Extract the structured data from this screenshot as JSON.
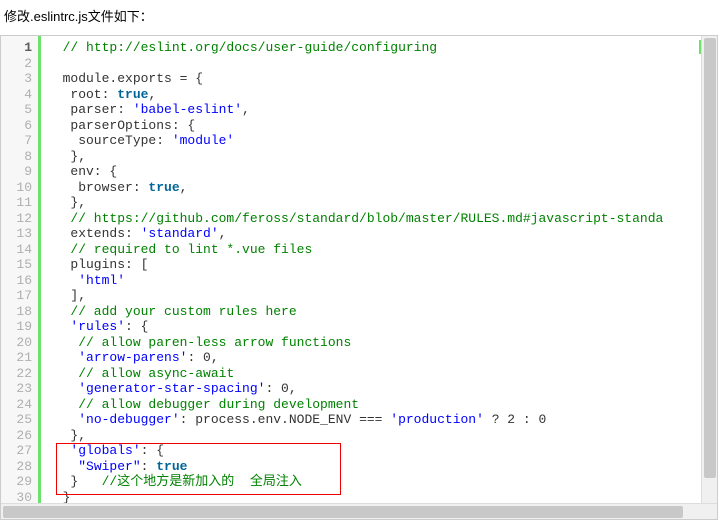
{
  "caption": "修改.eslintrc.js文件如下：",
  "code_lines": [
    {
      "n": 1,
      "hl": true,
      "segs": [
        {
          "t": "  ",
          "c": ""
        },
        {
          "t": "// http://eslint.org/docs/user-guide/configuring",
          "c": "c-comment"
        }
      ]
    },
    {
      "n": 2,
      "hl": false,
      "segs": []
    },
    {
      "n": 3,
      "hl": false,
      "segs": [
        {
          "t": "  module.exports = {",
          "c": ""
        }
      ]
    },
    {
      "n": 4,
      "hl": false,
      "segs": [
        {
          "t": "   root: ",
          "c": ""
        },
        {
          "t": "true",
          "c": "c-key"
        },
        {
          "t": ",",
          "c": ""
        }
      ]
    },
    {
      "n": 5,
      "hl": false,
      "segs": [
        {
          "t": "   parser: ",
          "c": ""
        },
        {
          "t": "'babel-eslint'",
          "c": "c-string"
        },
        {
          "t": ",",
          "c": ""
        }
      ]
    },
    {
      "n": 6,
      "hl": false,
      "segs": [
        {
          "t": "   parserOptions: {",
          "c": ""
        }
      ]
    },
    {
      "n": 7,
      "hl": false,
      "segs": [
        {
          "t": "    sourceType: ",
          "c": ""
        },
        {
          "t": "'module'",
          "c": "c-string"
        }
      ]
    },
    {
      "n": 8,
      "hl": false,
      "segs": [
        {
          "t": "   },",
          "c": ""
        }
      ]
    },
    {
      "n": 9,
      "hl": false,
      "segs": [
        {
          "t": "   env: {",
          "c": ""
        }
      ]
    },
    {
      "n": 10,
      "hl": false,
      "segs": [
        {
          "t": "    browser: ",
          "c": ""
        },
        {
          "t": "true",
          "c": "c-key"
        },
        {
          "t": ",",
          "c": ""
        }
      ]
    },
    {
      "n": 11,
      "hl": false,
      "segs": [
        {
          "t": "   },",
          "c": ""
        }
      ]
    },
    {
      "n": 12,
      "hl": false,
      "segs": [
        {
          "t": "   ",
          "c": ""
        },
        {
          "t": "// https://github.com/feross/standard/blob/master/RULES.md#javascript-standa",
          "c": "c-comment"
        }
      ]
    },
    {
      "n": 13,
      "hl": false,
      "segs": [
        {
          "t": "   extends: ",
          "c": ""
        },
        {
          "t": "'standard'",
          "c": "c-string"
        },
        {
          "t": ",",
          "c": ""
        }
      ]
    },
    {
      "n": 14,
      "hl": false,
      "segs": [
        {
          "t": "   ",
          "c": ""
        },
        {
          "t": "// required to lint *.vue files",
          "c": "c-comment"
        }
      ]
    },
    {
      "n": 15,
      "hl": false,
      "segs": [
        {
          "t": "   plugins: [",
          "c": ""
        }
      ]
    },
    {
      "n": 16,
      "hl": false,
      "segs": [
        {
          "t": "    ",
          "c": ""
        },
        {
          "t": "'html'",
          "c": "c-string"
        }
      ]
    },
    {
      "n": 17,
      "hl": false,
      "segs": [
        {
          "t": "   ],",
          "c": ""
        }
      ]
    },
    {
      "n": 18,
      "hl": false,
      "segs": [
        {
          "t": "   ",
          "c": ""
        },
        {
          "t": "// add your custom rules here",
          "c": "c-comment"
        }
      ]
    },
    {
      "n": 19,
      "hl": false,
      "segs": [
        {
          "t": "   ",
          "c": ""
        },
        {
          "t": "'rules'",
          "c": "c-string"
        },
        {
          "t": ": {",
          "c": ""
        }
      ]
    },
    {
      "n": 20,
      "hl": false,
      "segs": [
        {
          "t": "    ",
          "c": ""
        },
        {
          "t": "// allow paren-less arrow functions",
          "c": "c-comment"
        }
      ]
    },
    {
      "n": 21,
      "hl": false,
      "segs": [
        {
          "t": "    ",
          "c": ""
        },
        {
          "t": "'arrow-parens'",
          "c": "c-string"
        },
        {
          "t": ": 0,",
          "c": ""
        }
      ]
    },
    {
      "n": 22,
      "hl": false,
      "segs": [
        {
          "t": "    ",
          "c": ""
        },
        {
          "t": "// allow async-await",
          "c": "c-comment"
        }
      ]
    },
    {
      "n": 23,
      "hl": false,
      "segs": [
        {
          "t": "    ",
          "c": ""
        },
        {
          "t": "'generator-star-spacing'",
          "c": "c-string"
        },
        {
          "t": ": 0,",
          "c": ""
        }
      ]
    },
    {
      "n": 24,
      "hl": false,
      "segs": [
        {
          "t": "    ",
          "c": ""
        },
        {
          "t": "// allow debugger during development",
          "c": "c-comment"
        }
      ]
    },
    {
      "n": 25,
      "hl": false,
      "segs": [
        {
          "t": "    ",
          "c": ""
        },
        {
          "t": "'no-debugger'",
          "c": "c-string"
        },
        {
          "t": ": process.env.NODE_ENV === ",
          "c": ""
        },
        {
          "t": "'production'",
          "c": "c-string"
        },
        {
          "t": " ? 2 : 0",
          "c": ""
        }
      ]
    },
    {
      "n": 26,
      "hl": false,
      "segs": [
        {
          "t": "   },",
          "c": ""
        }
      ]
    },
    {
      "n": 27,
      "hl": false,
      "segs": [
        {
          "t": "   ",
          "c": ""
        },
        {
          "t": "'globals'",
          "c": "c-string"
        },
        {
          "t": ": {",
          "c": ""
        }
      ]
    },
    {
      "n": 28,
      "hl": false,
      "segs": [
        {
          "t": "    ",
          "c": ""
        },
        {
          "t": "\"Swiper\"",
          "c": "c-string"
        },
        {
          "t": ": ",
          "c": ""
        },
        {
          "t": "true",
          "c": "c-key"
        }
      ]
    },
    {
      "n": 29,
      "hl": false,
      "segs": [
        {
          "t": "   }   ",
          "c": ""
        },
        {
          "t": "//这个地方是新加入的  全局注入",
          "c": "c-comment"
        }
      ]
    },
    {
      "n": 30,
      "hl": false,
      "segs": [
        {
          "t": "  }",
          "c": ""
        }
      ]
    }
  ],
  "expand_icon": "?"
}
